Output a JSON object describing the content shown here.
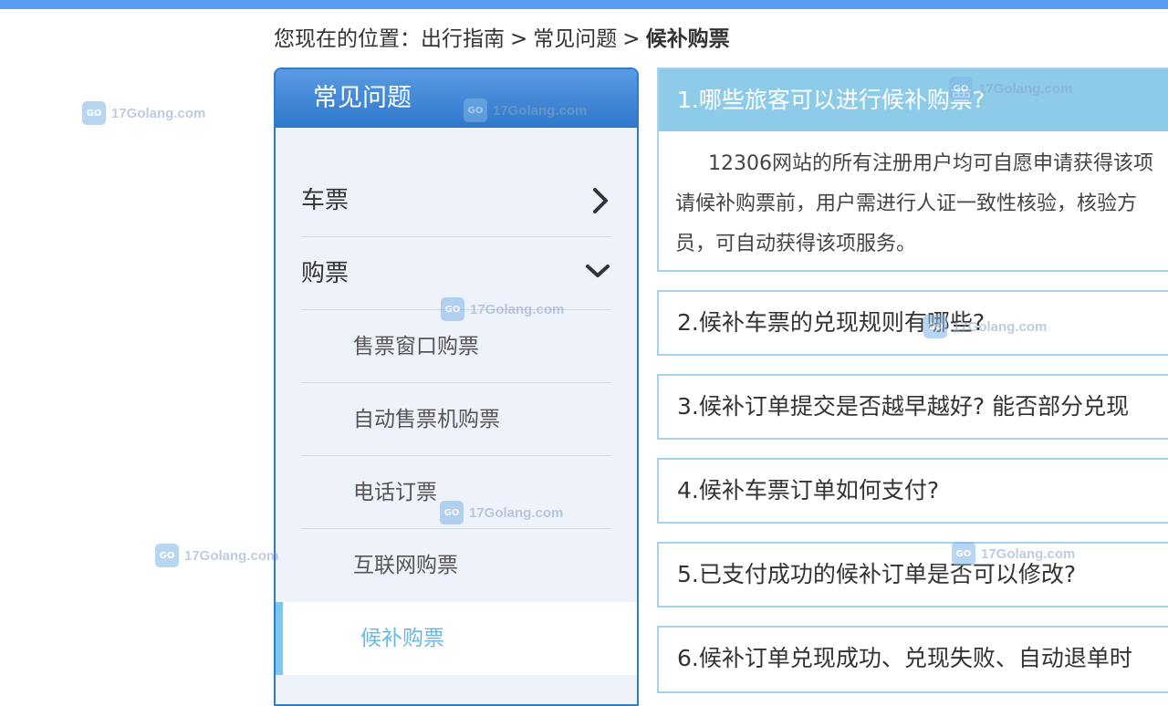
{
  "breadcrumb": {
    "prefix": "您现在的位置：",
    "items": [
      "出行指南",
      "常见问题"
    ],
    "current": "候补购票",
    "separator": ">"
  },
  "sidebar": {
    "title": "常见问题",
    "categories": [
      {
        "label": "车票",
        "state": "collapsed"
      },
      {
        "label": "购票",
        "state": "expanded"
      }
    ],
    "subitems": [
      {
        "label": "售票窗口购票"
      },
      {
        "label": "自动售票机购票"
      },
      {
        "label": "电话订票"
      },
      {
        "label": "互联网购票"
      },
      {
        "label": "候补购票",
        "active": true
      }
    ]
  },
  "faqs": [
    {
      "title": "1.哪些旅客可以进行候补购票?",
      "open": true,
      "body": [
        "12306网站的所有注册用户均可自愿申请获得该项",
        "请候补购票前，用户需进行人证一致性核验，核验方",
        "员，可自动获得该项服务。"
      ]
    },
    {
      "title": "2.候补车票的兑现规则有哪些?"
    },
    {
      "title": "3.候补订单提交是否越早越好? 能否部分兑现"
    },
    {
      "title": "4.候补车票订单如何支付?"
    },
    {
      "title": "5.已支付成功的候补订单是否可以修改?"
    },
    {
      "title": "6.候补订单兑现成功、兑现失败、自动退单时"
    }
  ],
  "watermark": {
    "text": "17Golang.com"
  },
  "colors": {
    "top_bar": "#5a9cf2",
    "sidebar_header": "#2e78cb",
    "active_item": "#6cb8e0",
    "faq_header": "#8ecbe8"
  }
}
